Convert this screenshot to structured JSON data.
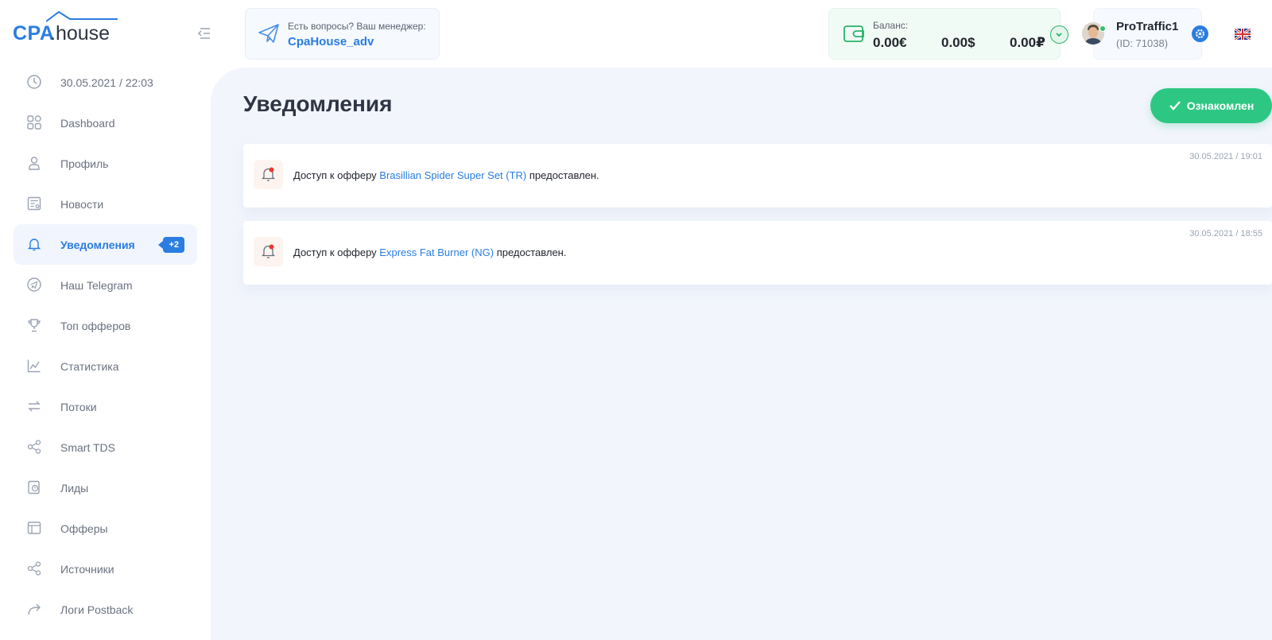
{
  "logo": {
    "part1": "CPA",
    "part2": ".house"
  },
  "sidebar": {
    "items": [
      {
        "label": "30.05.2021 / 22:03",
        "icon": "clock-icon"
      },
      {
        "label": "Dashboard",
        "icon": "dashboard-icon"
      },
      {
        "label": "Профиль",
        "icon": "user-icon"
      },
      {
        "label": "Новости",
        "icon": "news-icon"
      },
      {
        "label": "Уведомления",
        "icon": "bell-icon",
        "active": true,
        "badge": "+2"
      },
      {
        "label": "Наш Telegram",
        "icon": "telegram-icon"
      },
      {
        "label": "Топ офферов",
        "icon": "trophy-icon"
      },
      {
        "label": "Статистика",
        "icon": "chart-icon"
      },
      {
        "label": "Потоки",
        "icon": "flows-icon"
      },
      {
        "label": "Smart TDS",
        "icon": "share-icon"
      },
      {
        "label": "Лиды",
        "icon": "leads-icon"
      },
      {
        "label": "Офферы",
        "icon": "offers-icon"
      },
      {
        "label": "Источники",
        "icon": "sources-icon"
      },
      {
        "label": "Логи Postback",
        "icon": "redo-arrow-icon"
      }
    ]
  },
  "header": {
    "manager": {
      "question": "Есть вопросы? Ваш менеджер:",
      "name": "CpaHouse_adv"
    },
    "balance": {
      "label": "Баланс:",
      "eur": "0.00€",
      "usd": "0.00$",
      "rub": "0.00₽"
    },
    "user": {
      "name": "ProTraffic1",
      "id": "(ID: 71038)"
    }
  },
  "main": {
    "title": "Уведомления",
    "ack_label": "Ознакомлен",
    "notifications": [
      {
        "prefix": "Доступ к офферу",
        "offer": "Brasillian Spider Super Set (TR)",
        "suffix": "предоставлен.",
        "time": "30.05.2021 / 19:01"
      },
      {
        "prefix": "Доступ к офферу",
        "offer": "Express Fat Burner (NG)",
        "suffix": "предоставлен.",
        "time": "30.05.2021 / 18:55"
      }
    ]
  },
  "colors": {
    "accent": "#2a7de1",
    "success": "#2dc783",
    "main_bg": "#f2f5fc"
  }
}
